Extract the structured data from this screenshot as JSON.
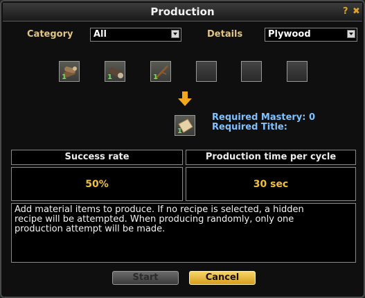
{
  "window": {
    "title": "Production",
    "help_icon": "?",
    "close_icon": "✖"
  },
  "filters": {
    "category_label": "Category",
    "category_value": "All",
    "details_label": "Details",
    "details_value": "Plywood"
  },
  "materials": [
    {
      "icon": "logs-icon",
      "qty": "1"
    },
    {
      "icon": "log-icon",
      "qty": "1"
    },
    {
      "icon": "branch-icon",
      "qty": "1"
    },
    {
      "icon": "empty-slot",
      "qty": ""
    },
    {
      "icon": "empty-slot",
      "qty": ""
    },
    {
      "icon": "empty-slot",
      "qty": ""
    }
  ],
  "result": {
    "icon": "plywood-icon",
    "qty": "1",
    "required_mastery": "Required Mastery: 0",
    "required_title": "Required Title:"
  },
  "stats": {
    "success_label": "Success rate",
    "success_value": "50%",
    "time_label": "Production time per cycle",
    "time_value": "30 sec"
  },
  "description": "Add material items to produce. If no recipe is selected, a hidden\nrecipe will be attempted. When producing randomly, only one\nproduction attempt will be made.",
  "buttons": {
    "start": "Start",
    "cancel": "Cancel"
  },
  "colors": {
    "label_gold": "#e0c585",
    "value_gold": "#f0c23a",
    "mastery_blue": "#7fc2ff",
    "qty_green": "#6ee05a"
  }
}
